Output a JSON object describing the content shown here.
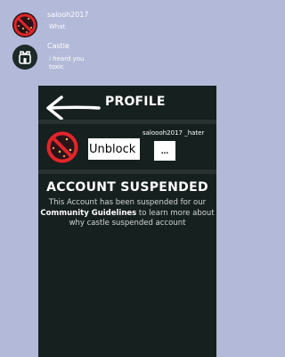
{
  "chat_list": {
    "items": [
      {
        "name": "salooh2017",
        "preview": "What"
      },
      {
        "name": "Castle",
        "preview": "i heard you toxic"
      }
    ]
  },
  "profile_panel": {
    "title": "PROFILE",
    "handle": "saloooh2017 _hater",
    "unblock_label": "Unblock",
    "more_label": "...",
    "suspended": {
      "heading": "ACCOUNT SUSPENDED",
      "text_before": "This Account has been suspended for our ",
      "link_text": "Community Guidelines",
      "text_after": " to learn more about why castle suspended account"
    }
  },
  "colors": {
    "background": "#b3b9d8",
    "panel": "#15201f",
    "no_sign_red": "#e0262b"
  }
}
